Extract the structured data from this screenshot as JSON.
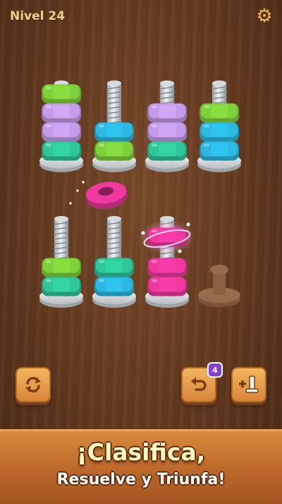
{
  "hud": {
    "level_label": "Nivel 24",
    "settings_icon": "gear-icon"
  },
  "colors": {
    "green": "#7fd13b",
    "lavender": "#c49be8",
    "teal": "#2fc79a",
    "cyan": "#2cb8e0",
    "pink": "#f0399f",
    "wood_button": "#e9a04f",
    "badge": "#8a3fd0"
  },
  "bolts": [
    {
      "id": "bolt-1",
      "nuts_bottom_to_top": [
        "teal",
        "lavender",
        "lavender",
        "green"
      ]
    },
    {
      "id": "bolt-2",
      "nuts_bottom_to_top": [
        "green",
        "cyan"
      ]
    },
    {
      "id": "bolt-3",
      "nuts_bottom_to_top": [
        "teal",
        "lavender",
        "lavender"
      ]
    },
    {
      "id": "bolt-4",
      "nuts_bottom_to_top": [
        "cyan",
        "cyan",
        "green"
      ]
    },
    {
      "id": "bolt-5",
      "nuts_bottom_to_top": [
        "teal",
        "green"
      ]
    },
    {
      "id": "bolt-6",
      "nuts_bottom_to_top": [
        "cyan",
        "teal"
      ]
    },
    {
      "id": "bolt-7",
      "nuts_bottom_to_top": [
        "pink",
        "pink"
      ],
      "floating_nut": "pink"
    },
    {
      "id": "bolt-8",
      "nuts_bottom_to_top": [],
      "locked": true
    }
  ],
  "loose_nut": {
    "color": "pink"
  },
  "controls": {
    "restart_icon": "refresh-icon",
    "undo_icon": "undo-icon",
    "undo_count": "4",
    "add_bolt_icon": "add-bolt-icon"
  },
  "banner": {
    "line1": "¡Clasifica,",
    "line2": "Resuelve y Triunfa!"
  }
}
